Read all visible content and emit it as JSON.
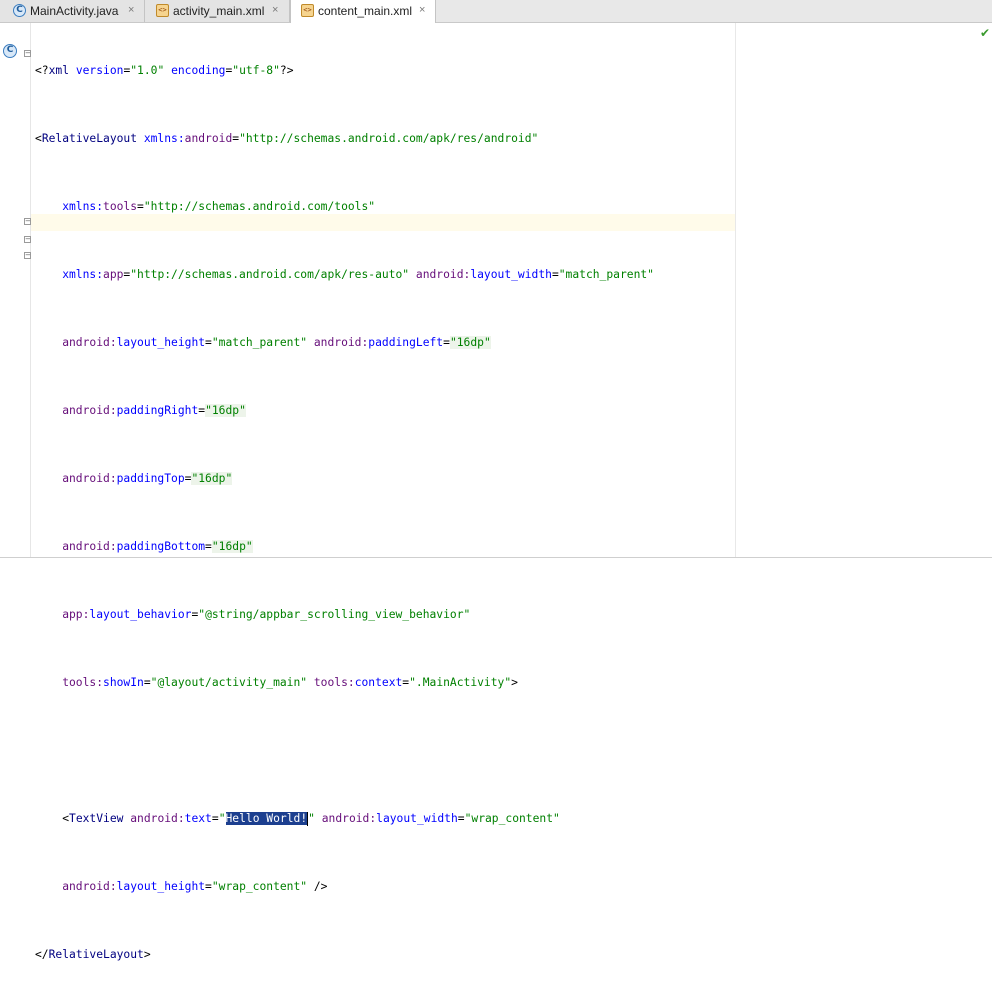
{
  "tabs": [
    {
      "label": "MainActivity.java",
      "icon": "java-class-icon",
      "icon_glyph": "C",
      "active": false
    },
    {
      "label": "activity_main.xml",
      "icon": "xml-layout-icon",
      "icon_glyph": "<>",
      "active": false
    },
    {
      "label": "content_main.xml",
      "icon": "xml-layout-icon",
      "icon_glyph": "<>",
      "active": true
    }
  ],
  "tab_close_glyph": "×",
  "editor": {
    "status_icon": "inspection-ok-icon",
    "status_glyph": "✔",
    "gutter_class_glyph": "C",
    "fold_glyph": "−",
    "code": {
      "l1": {
        "a": "<?",
        "b": "xml",
        "c": " version",
        "d": "=",
        "e": "\"1.0\"",
        "f": " encoding",
        "g": "=",
        "h": "\"utf-8\"",
        "i": "?>"
      },
      "l2": {
        "a": "<",
        "b": "RelativeLayout",
        "c": " xmlns:",
        "d": "android",
        "e": "=",
        "f": "\"http://schemas.android.com/apk/res/android\""
      },
      "l3": {
        "a": "    xmlns:",
        "b": "tools",
        "c": "=",
        "d": "\"http://schemas.android.com/tools\""
      },
      "l4": {
        "a": "    xmlns:",
        "b": "app",
        "c": "=",
        "d": "\"http://schemas.android.com/apk/res-auto\"",
        "e": " android:",
        "f": "layout_width",
        "g": "=",
        "h": "\"match_parent\""
      },
      "l5": {
        "a": "    android:",
        "b": "layout_height",
        "c": "=",
        "d": "\"match_parent\"",
        "e": " android:",
        "f": "paddingLeft",
        "g": "=",
        "h": "\"16dp\""
      },
      "l6": {
        "a": "    android:",
        "b": "paddingRight",
        "c": "=",
        "d": "\"16dp\""
      },
      "l7": {
        "a": "    android:",
        "b": "paddingTop",
        "c": "=",
        "d": "\"16dp\""
      },
      "l8": {
        "a": "    android:",
        "b": "paddingBottom",
        "c": "=",
        "d": "\"16dp\""
      },
      "l9": {
        "a": "    app:",
        "b": "layout_behavior",
        "c": "=",
        "d": "\"@string/appbar_scrolling_view_behavior\""
      },
      "l10": {
        "a": "    tools:",
        "b": "showIn",
        "c": "=",
        "d": "\"@layout/activity_main\"",
        "e": " tools:",
        "f": "context",
        "g": "=",
        "h": "\".MainActivity\"",
        "i": ">"
      },
      "l11": "",
      "l12": {
        "a": "    <",
        "b": "TextView",
        "c": " android:",
        "d": "text",
        "e": "=",
        "f": "\"",
        "g": "Hello World!",
        "h": "\"",
        "i": " android:",
        "j": "layout_width",
        "k": "=",
        "l": "\"wrap_content\""
      },
      "l13": {
        "a": "    android:",
        "b": "layout_height",
        "c": "=",
        "d": "\"wrap_content\"",
        "e": " />"
      },
      "l14": {
        "a": "</",
        "b": "RelativeLayout",
        "c": ">"
      }
    }
  },
  "colors": {
    "xml_tag": "#000080",
    "attribute_name": "#0000ff",
    "namespace": "#660e7a",
    "attribute_value": "#008000",
    "selection": "#1c3f8f",
    "current_line": "#fffbea"
  }
}
